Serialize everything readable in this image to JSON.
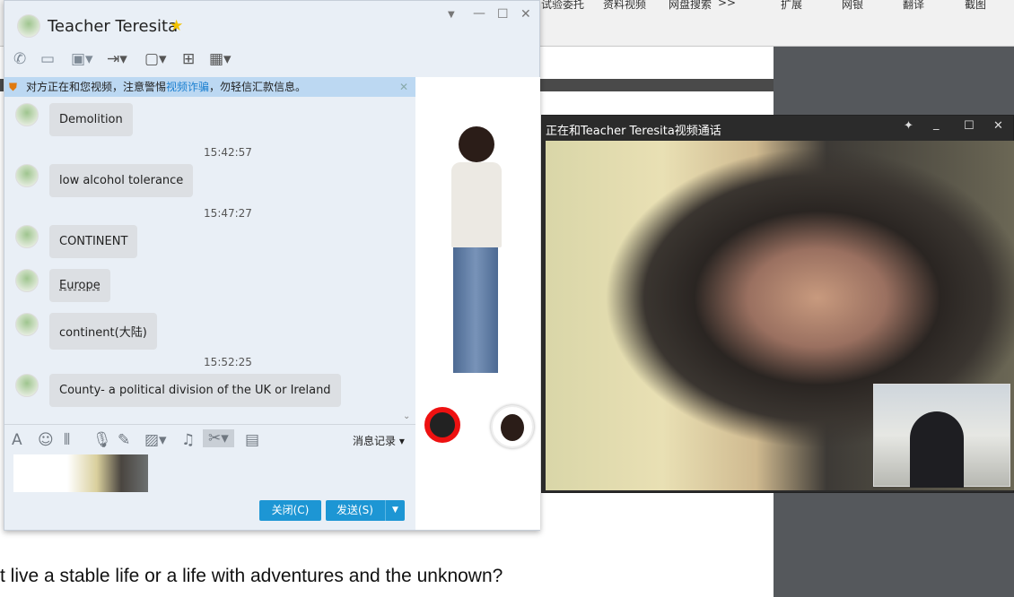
{
  "browser": {
    "bookmarks": [
      "试验委托",
      "资料视频",
      "网盘搜索",
      ">>"
    ],
    "tools": [
      "扩展",
      "网银",
      "翻译",
      "截图"
    ]
  },
  "document": {
    "lines": [
      "t live a stable life or a life with adventures and the unknown?"
    ]
  },
  "qq": {
    "title": "Teacher Teresita",
    "notice": {
      "before": "对方正在和您视频，注意警惕",
      "link": "视频诈骗",
      "after": "，勿轻信汇款信息。"
    },
    "messages": [
      {
        "type": "msg",
        "text": "Demolition"
      },
      {
        "type": "time",
        "text": "15:42:57"
      },
      {
        "type": "msg",
        "text": "low alcohol tolerance"
      },
      {
        "type": "time",
        "text": "15:47:27"
      },
      {
        "type": "msg",
        "text": "CONTINENT"
      },
      {
        "type": "msg",
        "text": "Europe"
      },
      {
        "type": "msg",
        "text": "continent(大陆)"
      },
      {
        "type": "time",
        "text": "15:52:25"
      },
      {
        "type": "msg",
        "text": "County- a political division of the UK or Ireland"
      }
    ],
    "history_label": "消息记录",
    "close_button": "关闭(C)",
    "send_button": "发送(S)"
  },
  "video": {
    "title": "正在和Teacher Teresita视频通话"
  },
  "colors": {
    "accent": "#1d96d4",
    "notice_bg": "#bcd8f2",
    "link": "#1a7fd0"
  }
}
